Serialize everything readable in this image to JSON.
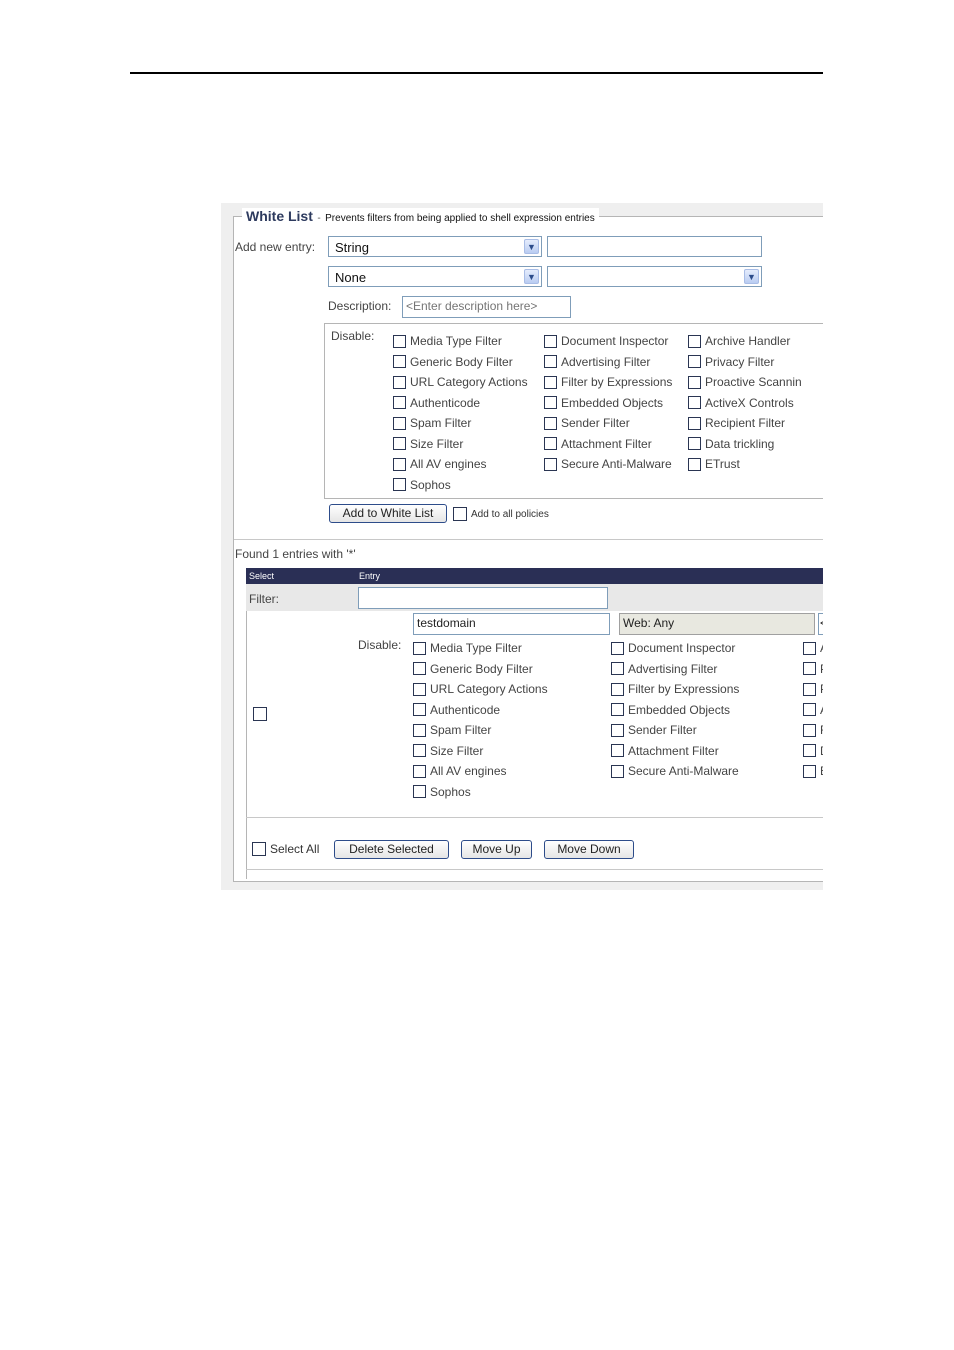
{
  "whitelist": {
    "title": "White List",
    "sep": "-",
    "description": "Prevents filters from being applied to shell expression entries",
    "add_new_entry_label": "Add new entry:",
    "type_select": "String",
    "second_select": "None",
    "description_label": "Description:",
    "description_placeholder": "<Enter description here>",
    "disable_label": "Disable:",
    "filters_col1": [
      "Media Type Filter",
      "Generic Body Filter",
      "URL Category Actions",
      "Authenticode",
      "Spam Filter",
      "Size Filter",
      "All AV engines",
      "Sophos"
    ],
    "filters_col2": [
      "Document Inspector",
      "Advertising Filter",
      "Filter by Expressions",
      "Embedded Objects",
      "Sender Filter",
      "Attachment Filter",
      "Secure Anti-Malware"
    ],
    "filters_col3": [
      "Archive Handler",
      "Privacy Filter",
      "Proactive Scannin",
      "ActiveX Controls",
      "Recipient Filter",
      "Data trickling",
      "ETrust"
    ],
    "add_button": "Add to White List",
    "add_all_policies": "Add to all policies"
  },
  "results": {
    "found_text": "Found 1 entries with '*'",
    "col_select": "Select",
    "col_entry": "Entry",
    "filter_label": "Filter:",
    "entry_value": "testdomain",
    "entry_type": "Web: Any",
    "entry_third": "<",
    "disable_label": "Disable:",
    "col1": [
      "Media Type Filter",
      "Generic Body Filter",
      "URL Category Actions",
      "Authenticode",
      "Spam Filter",
      "Size Filter",
      "All AV engines",
      "Sophos"
    ],
    "col2": [
      "Document Inspector",
      "Advertising Filter",
      "Filter by Expressions",
      "Embedded Objects",
      "Sender Filter",
      "Attachment Filter",
      "Secure Anti-Malware"
    ],
    "col3": [
      "A",
      "P",
      "P",
      "A",
      "R",
      "D",
      "E"
    ],
    "select_all": "Select All",
    "delete_selected": "Delete Selected",
    "move_up": "Move Up",
    "move_down": "Move Down"
  },
  "icons": {
    "dropdown": "▼"
  },
  "colors": {
    "header_bar": "#2a2f55",
    "title": "#2d3a5e",
    "border": "#7f9db9"
  }
}
